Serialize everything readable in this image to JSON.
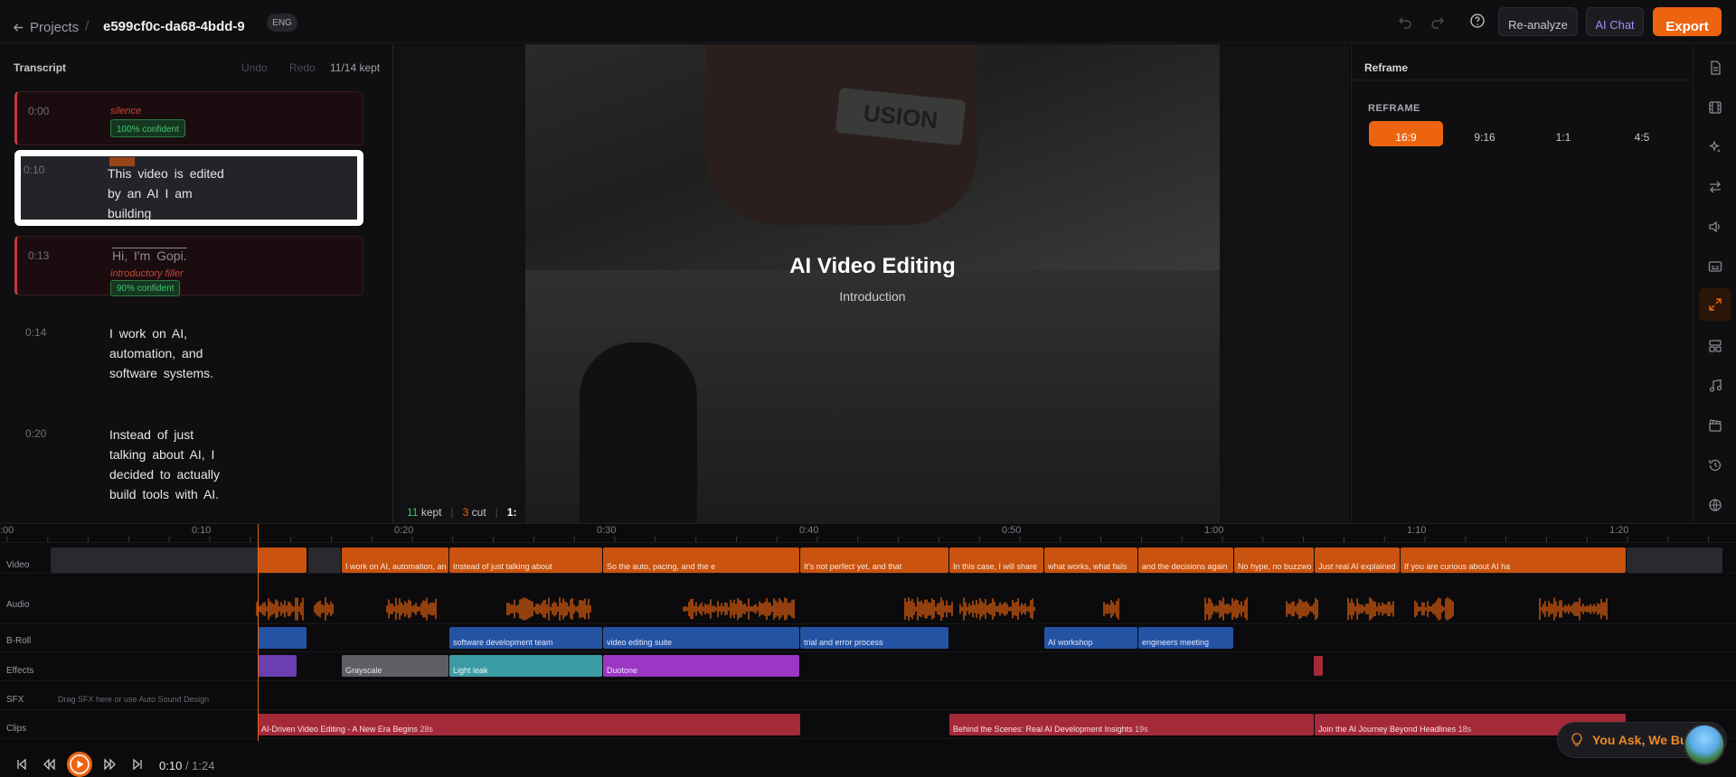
{
  "topbar": {
    "back_label": "Projects",
    "separator": "/",
    "project_title": "e599cf0c-da68-4bdd-9",
    "language": "ENG",
    "reanalyze_label": "Re-analyze",
    "ai_chat_label": "AI Chat",
    "export_label": "Export"
  },
  "transcript": {
    "heading": "Transcript",
    "undo_label": "Undo",
    "redo_label": "Redo",
    "kept_count": "11/14 kept",
    "segments": [
      {
        "time": "0:00",
        "text": "",
        "note": "silence",
        "confidence": "100% confident",
        "cut": true
      },
      {
        "time": "0:10",
        "text": "This video is edited by an AI I am building",
        "active": true
      },
      {
        "time": "0:13",
        "text": "Hi, I'm Gopi.",
        "note": "introductory filler",
        "confidence": "90% confident",
        "cut": true
      },
      {
        "time": "0:14",
        "text": "I work on AI, automation, and software systems."
      },
      {
        "time": "0:20",
        "text": "Instead of just talking about AI, I decided to actually build tools with AI."
      }
    ]
  },
  "preview": {
    "title": "AI Video Editing",
    "subtitle": "Introduction",
    "logo_text": "USION",
    "kept_count": "11",
    "kept_label": "kept",
    "cut_count": "3",
    "cut_label": "cut",
    "separator": "|",
    "extra": "1:"
  },
  "reframe": {
    "heading": "Reframe",
    "label": "REFRAME",
    "options": [
      "16:9",
      "9:16",
      "1:1",
      "4:5"
    ],
    "selected": "16:9"
  },
  "timeline": {
    "ruler": [
      ":00",
      "0:10",
      "0:20",
      "0:30",
      "0:40",
      "0:50",
      "1:00",
      "1:10",
      "1:20"
    ],
    "tracks": [
      "Video",
      "Audio",
      "B-Roll",
      "Effects",
      "SFX",
      "Clips"
    ],
    "sfx_hint": "Drag SFX here or use Auto Sound Design",
    "video_clips": [
      "",
      "",
      "I work on AI, automation, an",
      "Instead of just talking about",
      "So the auto, pacing, and the e",
      "It's not perfect yet, and that",
      "In this case, I will share",
      "what works, what fails",
      "and the decisions again",
      "No hype, no buzzwo",
      "Just real AI explained",
      "If you are curious about AI ha"
    ],
    "broll_clips": [
      "",
      "software development team",
      "video editing suite",
      "trial and error process",
      "AI workshop",
      "engineers meeting"
    ],
    "effects_clips": [
      "",
      "Grayscale",
      "Light leak",
      "Duotone",
      ""
    ],
    "clips": [
      {
        "title": "AI-Driven Video Editing - A New Era Begins",
        "duration": "28s"
      },
      {
        "title": "Behind the Scenes: Real AI Development Insights",
        "duration": "19s"
      },
      {
        "title": "Join the AI Journey Beyond Headlines",
        "duration": "18s"
      }
    ],
    "current_time": "0:10",
    "total_time": "/ 1:24"
  },
  "toast": {
    "text": "You Ask, We Build"
  },
  "colors": {
    "accent": "#ec6410",
    "cut": "#c23a3a",
    "confidence": "#43c46b",
    "broll": "#2453a3",
    "clips": "#a42a3a"
  }
}
